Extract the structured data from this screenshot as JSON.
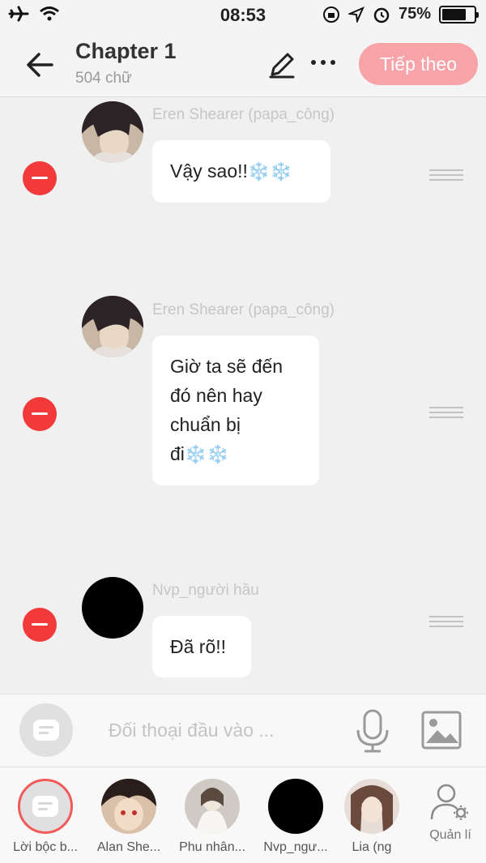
{
  "status": {
    "time": "08:53",
    "battery_text": "75%",
    "battery_level": 0.75
  },
  "header": {
    "title": "Chapter 1",
    "subtitle": "504 chữ",
    "next_label": "Tiếp theo",
    "icons": [
      "back-arrow-icon",
      "pencil-icon",
      "more-icon"
    ]
  },
  "messages": [
    {
      "sender": "Eren Shearer (papa_công)",
      "text": "Vậy sao!!",
      "emoji": "❄️❄️",
      "avatar": "anime-boy-dark"
    },
    {
      "sender": "Eren Shearer (papa_công)",
      "lines": [
        "Giờ ta sẽ đến",
        "đó nên hay",
        "chuẩn bị",
        "đi"
      ],
      "emoji": "❄️❄️",
      "avatar": "anime-boy-dark"
    },
    {
      "sender": "Nvp_người hầu",
      "text": "Đã rõ!!",
      "avatar": "black"
    }
  ],
  "input": {
    "placeholder": "Đối thoại đầu vào ..."
  },
  "characters": [
    {
      "label": "Lời bộc b...",
      "type": "narration"
    },
    {
      "label": "Alan She...",
      "type": "anime-boy-red"
    },
    {
      "label": "Phu nhân...",
      "type": "girl-white"
    },
    {
      "label": "Nvp_ngư...",
      "type": "black"
    },
    {
      "label": "Lia (ng",
      "type": "girl-brown"
    }
  ],
  "manage": {
    "label": "Quản lí"
  },
  "colors": {
    "accent": "#f7a3a8",
    "remove": "#f23a3a",
    "background": "#f0f0f0"
  }
}
